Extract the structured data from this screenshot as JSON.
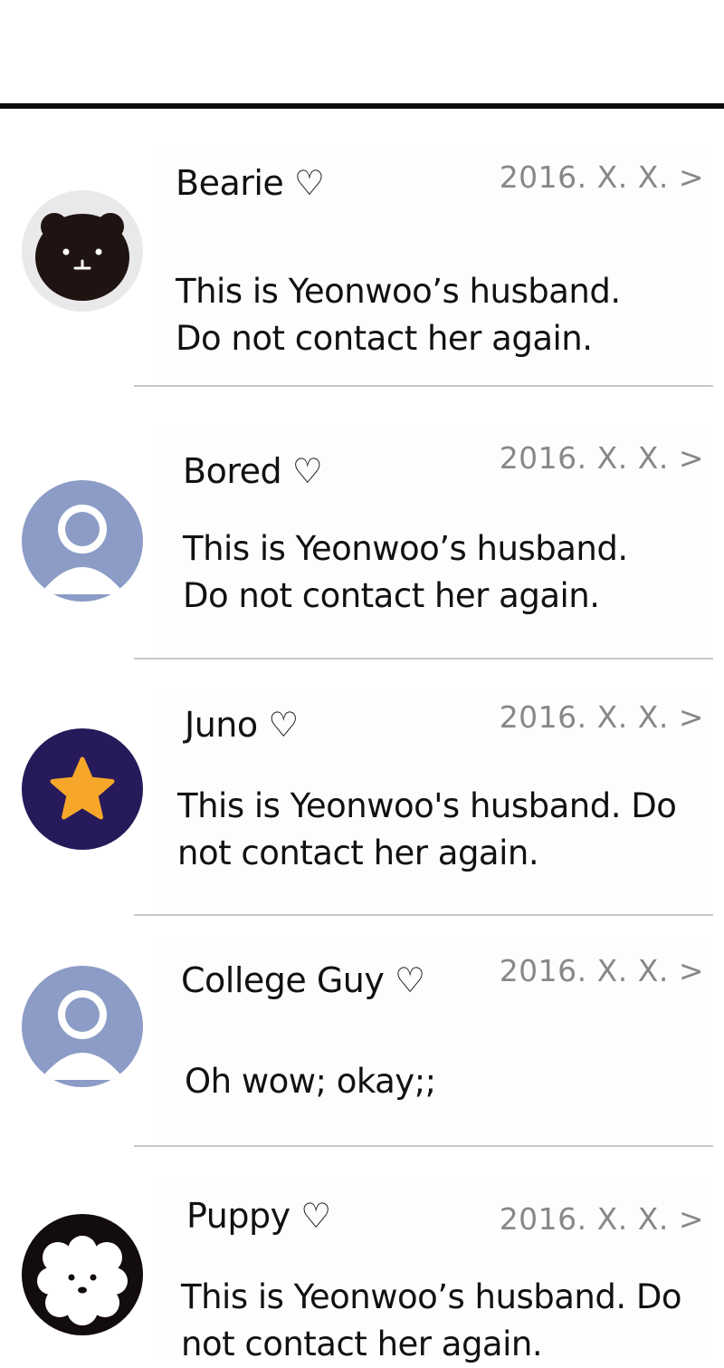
{
  "conversations": [
    {
      "name": "Bearie",
      "heart": "♡",
      "date": "2016. X. X.",
      "chevron": ">",
      "avatar": "bear-face",
      "message_lines": [
        "This is Yeonwoo’s husband.",
        "Do not contact her again."
      ]
    },
    {
      "name": "Bored",
      "heart": "♡",
      "date": "2016. X. X.",
      "chevron": ">",
      "avatar": "default-user",
      "message_lines": [
        "This is Yeonwoo’s husband.",
        "Do not contact her again."
      ]
    },
    {
      "name": "Juno",
      "heart": "♡",
      "date": "2016. X. X.",
      "chevron": ">",
      "avatar": "star",
      "message_lines": [
        "This is Yeonwoo's husband. Do",
        "not contact her again."
      ]
    },
    {
      "name": "College Guy",
      "heart": "♡",
      "date": "2016. X. X.",
      "chevron": ">",
      "avatar": "default-user",
      "message_lines": [
        "Oh wow; okay;;"
      ]
    },
    {
      "name": "Puppy",
      "heart": "♡",
      "date": "2016. X. X.",
      "chevron": ">",
      "avatar": "puppy-face",
      "message_lines": [
        "This is Yeonwoo’s husband. Do",
        "not contact her again."
      ]
    }
  ],
  "colors": {
    "default_avatar_bg": "#8c9cc6",
    "bear_bg": "#e9e9e9",
    "bear_face": "#1f1412",
    "star_bg": "#261a5a",
    "star": "#f6a72a",
    "puppy_bg": "#130c0c",
    "date_text": "#888888",
    "divider": "#c8c8c8"
  }
}
